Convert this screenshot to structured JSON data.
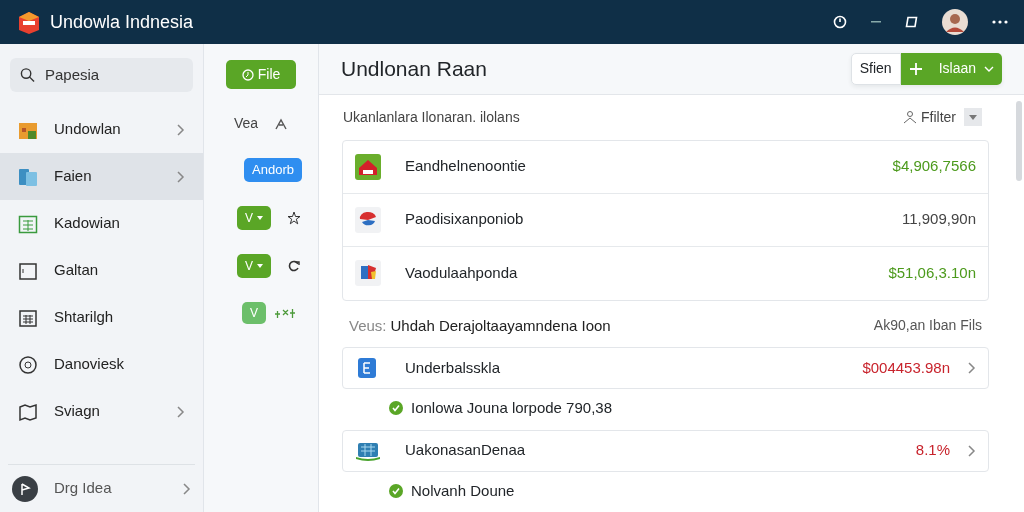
{
  "app": {
    "title": "Undowla Indnesia"
  },
  "search": {
    "placeholder": "Papesia"
  },
  "sidebar": {
    "items": [
      {
        "label": "Undowlan",
        "chevron": true,
        "selected": false
      },
      {
        "label": "Faien",
        "chevron": true,
        "selected": true
      },
      {
        "label": "Kadowian",
        "chevron": false,
        "selected": false
      },
      {
        "label": "Galtan",
        "chevron": false,
        "selected": false
      },
      {
        "label": "Shtarilgh",
        "chevron": false,
        "selected": false
      },
      {
        "label": "Danoviesk",
        "chevron": false,
        "selected": false
      },
      {
        "label": "Sviagn",
        "chevron": true,
        "selected": false
      }
    ],
    "footer": {
      "label": "Drg Idea"
    }
  },
  "tools": {
    "file_button": "File",
    "view_label": "Vea",
    "action_button": "Andorb",
    "dropdowns": [
      {
        "label": "V"
      },
      {
        "label": "V"
      }
    ],
    "check_button": "V"
  },
  "main": {
    "title": "Undlonan Raan",
    "secondary_button": "Sfien",
    "primary_button": "Islaan",
    "section1": {
      "label": "Ukanlanlara Ilonaran. ilolans",
      "filter": "Ffilter",
      "rows": [
        {
          "name": "Eandhelnenoontie",
          "amount": "$4,906,7566",
          "color": "#4c9a1c"
        },
        {
          "name": "Paodisixanponiob",
          "amount": "11,909,90n",
          "color": "#444444"
        },
        {
          "name": "Vaodulaahponda",
          "amount": "$51,06,3.10n",
          "color": "#4c9a1c"
        }
      ]
    },
    "section2": {
      "prefix": "Veus:",
      "label": "Uhdah Derajoltaayamndena Ioon",
      "right": "Ak90,an Iban Fils",
      "rows": [
        {
          "name": "Underbalsskla",
          "amount": "$004453.98n",
          "color": "#c8232c",
          "note": "Ionlowa Jouna lorpode 790,38"
        },
        {
          "name": "UakonasanDenaa",
          "amount": "8.1%",
          "color": "#c8232c",
          "note": "Nolvanh Doune"
        }
      ]
    }
  }
}
